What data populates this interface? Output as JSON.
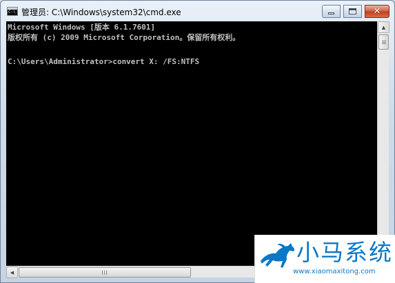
{
  "window": {
    "title": "管理员: C:\\Windows\\system32\\cmd.exe",
    "icon": "cmd-icon",
    "icon_text": "C:\\"
  },
  "controls": {
    "minimize": "minimize-icon",
    "maximize": "maximize-icon",
    "close": "close-icon",
    "close_glyph": "✕"
  },
  "console": {
    "lines": [
      "Microsoft Windows [版本 6.1.7601]",
      "版权所有 (c) 2009 Microsoft Corporation。保留所有权利。",
      "",
      "C:\\Users\\Administrator>convert X: /FS:NTFS"
    ],
    "text_color": "#c0c0c0",
    "background": "#000000"
  },
  "scrollbars": {
    "up_arrow": "▲",
    "down_arrow": "▼",
    "left_arrow": "◀",
    "right_arrow": "▶"
  },
  "watermark": {
    "brand": "小马系统",
    "url": "www.xiaomaxitong.com",
    "color": "#0a78c6",
    "icon": "horse-logo-icon"
  }
}
